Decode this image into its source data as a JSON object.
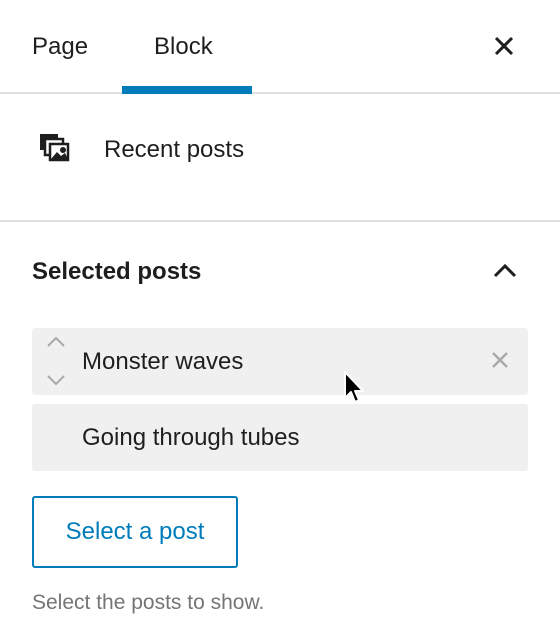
{
  "tabs": {
    "page_label": "Page",
    "block_label": "Block",
    "active": "Block"
  },
  "block_card": {
    "icon": "gallery-icon",
    "title": "Recent posts"
  },
  "panel": {
    "title": "Selected posts",
    "expanded": true,
    "posts": [
      {
        "label": "Monster waves"
      },
      {
        "label": "Going through tubes"
      }
    ],
    "select_button_label": "Select a post",
    "help_text": "Select the posts to show."
  },
  "colors": {
    "accent": "#007cba",
    "item_background": "#f0f0f0",
    "divider": "#e0e0e0",
    "muted_text": "#757575"
  }
}
